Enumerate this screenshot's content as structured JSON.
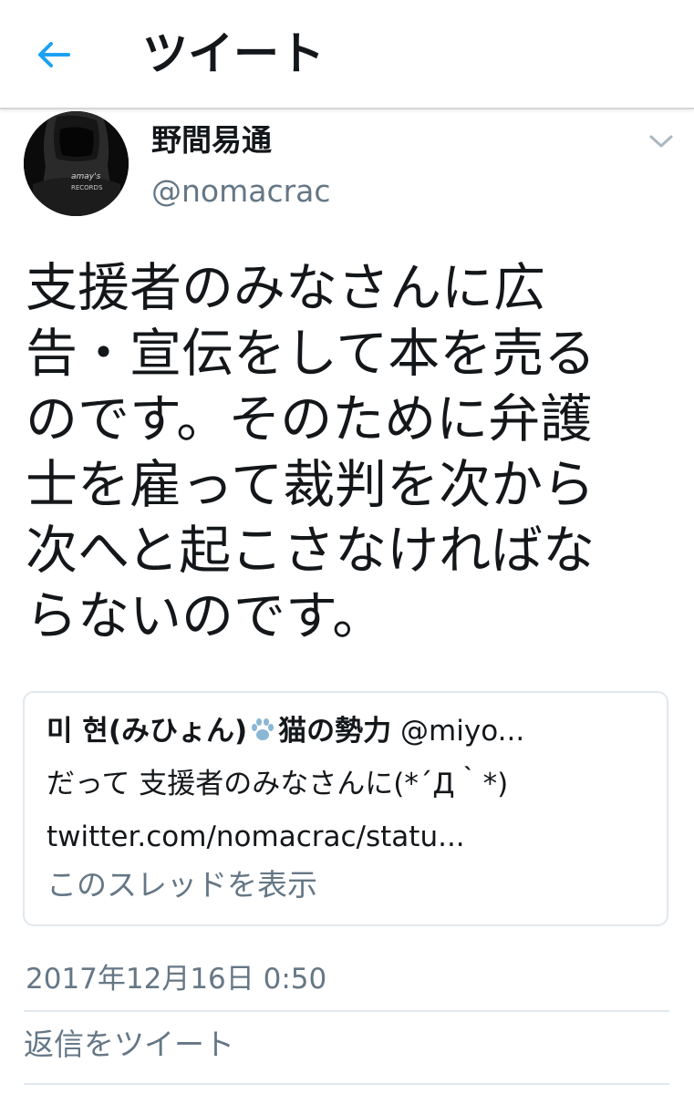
{
  "header": {
    "title": "ツイート",
    "back_icon": "arrow-left-icon",
    "accent_color": "#1da1f2"
  },
  "author": {
    "display_name": "野間易通",
    "screen_name": "@nomacrac",
    "avatar_caption_line1": "amay's",
    "avatar_caption_line2": "RECORDS"
  },
  "tweet": {
    "lines": [
      "支援者のみなさんに広",
      "告・宣伝をして本を売る",
      "のです。そのために弁護",
      "士を雇って裁判を次から",
      "次へと起こさなければな",
      "らないのです。"
    ],
    "timestamp": "2017年12月16日 0:50"
  },
  "quoted_tweet": {
    "name_before_icon": "미 현(みひょん)",
    "icon": "paw-icon",
    "name_after_icon": "猫の勢力",
    "handle": "@miyo...",
    "text": "だって 支援者のみなさんに(*´Д｀*)",
    "link": "twitter.com/nomacrac/statu...",
    "show_thread_label": "このスレッドを表示"
  },
  "reply": {
    "placeholder": "返信をツイート"
  }
}
